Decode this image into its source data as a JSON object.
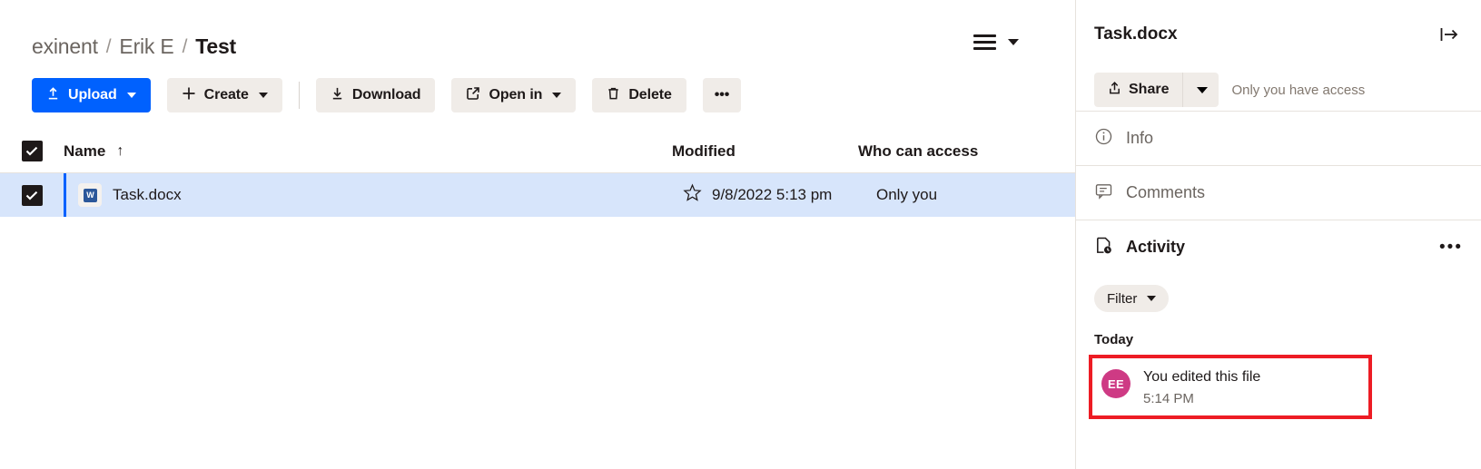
{
  "breadcrumb": {
    "items": [
      {
        "label": "exinent",
        "current": false
      },
      {
        "label": "Erik E",
        "current": false
      },
      {
        "label": "Test",
        "current": true
      }
    ],
    "separator": "/"
  },
  "view_toggle": {
    "icon": "list-view-icon",
    "chevron": "chevron-down-icon"
  },
  "toolbar": {
    "upload_label": "Upload",
    "create_label": "Create",
    "download_label": "Download",
    "open_in_label": "Open in",
    "delete_label": "Delete",
    "more_label": "•••",
    "primary_color": "#0061fe",
    "button_bg": "#f0ece8"
  },
  "table": {
    "headers": {
      "name": "Name",
      "sort_indicator": "↑",
      "modified": "Modified",
      "who_can_access": "Who can access"
    },
    "select_all_checked": true,
    "rows": [
      {
        "selected": true,
        "checked": true,
        "name": "Task.docx",
        "icon": "word-document-icon",
        "icon_glyph": "W",
        "starred": false,
        "modified": "9/8/2022 5:13 pm",
        "who_can_access": "Only you"
      }
    ],
    "selection_bg": "#d7e5fb",
    "selection_bar": "#0061fe"
  },
  "panel": {
    "title": "Task.docx",
    "collapse_icon": "collapse-panel-right-icon",
    "share": {
      "label": "Share",
      "icon": "share-icon",
      "caret": "chevron-down-icon",
      "access_note": "Only you have access"
    },
    "sections": [
      {
        "label": "Info",
        "icon": "info-circle-icon",
        "active": false
      },
      {
        "label": "Comments",
        "icon": "comment-bubble-icon",
        "active": false
      },
      {
        "label": "Activity",
        "icon": "activity-document-clock-icon",
        "active": true,
        "overflow": "•••"
      }
    ],
    "filter": {
      "label": "Filter",
      "chevron": "chevron-down-icon"
    },
    "activity": {
      "group_label": "Today",
      "items": [
        {
          "avatar_initials": "EE",
          "avatar_color": "#ce3a84",
          "text": "You edited this file",
          "time": "5:14 PM",
          "highlighted": true
        }
      ],
      "highlight_color": "#ed1c24"
    }
  }
}
